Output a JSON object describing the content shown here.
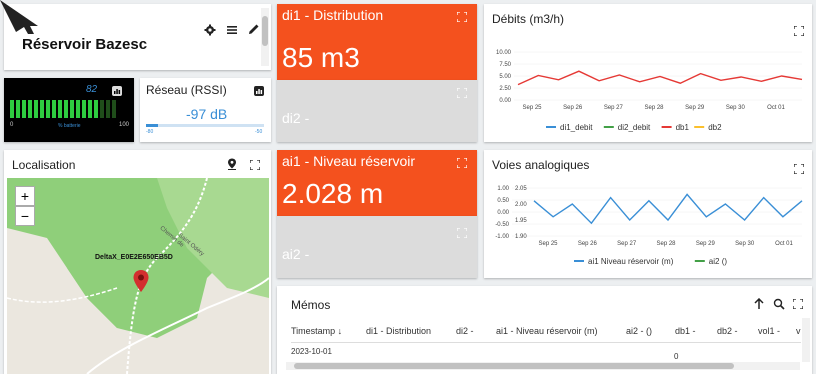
{
  "header_card": {
    "title": "Réservoir Bazesc"
  },
  "battery_card": {
    "value": "82",
    "caption": "% batterie",
    "bar_min": "0",
    "bar_max": "100"
  },
  "rssi_card": {
    "title": "Réseau (RSSI)",
    "value": "-97 dB",
    "scale_min": "-80",
    "scale_max": "-50"
  },
  "map_card": {
    "title": "Localisation",
    "device_label": "DeltaX_E0E2E650EB5D",
    "road_label_1": "Chemin de",
    "road_label_2": "Saint Odéry"
  },
  "di1_card": {
    "title": "di1 - Distribution",
    "value": "85 m3"
  },
  "di2_card": {
    "title": "di2 -"
  },
  "ai1_card": {
    "title": "ai1 - Niveau réservoir",
    "value": "2.028 m"
  },
  "ai2_card": {
    "title": "ai2 -"
  },
  "memos_card": {
    "title": "Mémos",
    "columns": [
      "Timestamp ↓",
      "di1 - Distribution",
      "di2 -",
      "ai1 - Niveau réservoir (m)",
      "ai2 - ()",
      "db1 -",
      "db2 -",
      "vol1 -",
      "v"
    ],
    "first_row": "2023-10-01",
    "partial_cell": "0"
  },
  "colors": {
    "orange": "#f4511e",
    "grey_tile": "#dcdcdc",
    "line_red": "#e53935",
    "line_blue": "#3a8fd6",
    "green": "#43a047",
    "yellow": "#fbc02d",
    "map_green": "#8fcf7a"
  },
  "icons": [
    "settings-icon",
    "list-icon",
    "edit-icon",
    "fullscreen-icon",
    "pin-icon",
    "arrow-up-icon",
    "search-icon",
    "chart-icon"
  ],
  "chart_data": [
    {
      "type": "line",
      "title": "Débits (m3/h)",
      "x": [
        "Sep 25",
        "Sep 26",
        "Sep 27",
        "Sep 28",
        "Sep 29",
        "Sep 30",
        "Oct 01"
      ],
      "ylim": [
        0,
        10
      ],
      "yticks": [
        "10.00",
        "7.50",
        "5.00",
        "2.50",
        "0.00"
      ],
      "series": [
        {
          "name": "di1_debit",
          "color": "#3a8fd6",
          "values": []
        },
        {
          "name": "di2_debit",
          "color": "#43a047",
          "values": []
        },
        {
          "name": "db1",
          "color": "#e53935",
          "values": [
            3.2,
            5.1,
            4.2,
            6.0,
            4.0,
            5.2,
            3.8,
            4.9,
            3.5,
            5.5,
            4.1,
            4.8,
            3.9,
            5.0,
            4.3
          ]
        },
        {
          "name": "db2",
          "color": "#fbc02d",
          "values": []
        }
      ]
    },
    {
      "type": "line",
      "title": "Voies analogiques",
      "x": [
        "Sep 25",
        "Sep 26",
        "Sep 27",
        "Sep 28",
        "Sep 29",
        "Sep 30",
        "Oct 01"
      ],
      "ylim_left": [
        -1,
        1
      ],
      "yticks_left": [
        "1.00",
        "0.50",
        "0.00",
        "-0.50",
        "-1.00"
      ],
      "ylim_right": [
        1.9,
        2.05
      ],
      "yticks_right": [
        "2.05",
        "2.00",
        "1.95",
        "1.90"
      ],
      "series": [
        {
          "name": "ai1 Niveau réservoir (m)",
          "color": "#3a8fd6",
          "values": [
            2.01,
            1.96,
            2.0,
            1.94,
            2.02,
            1.95,
            2.01,
            1.95,
            2.03,
            1.96,
            2.0,
            1.95,
            2.02,
            1.96,
            2.01
          ]
        },
        {
          "name": "ai2 ()",
          "color": "#43a047",
          "values": []
        }
      ]
    }
  ]
}
